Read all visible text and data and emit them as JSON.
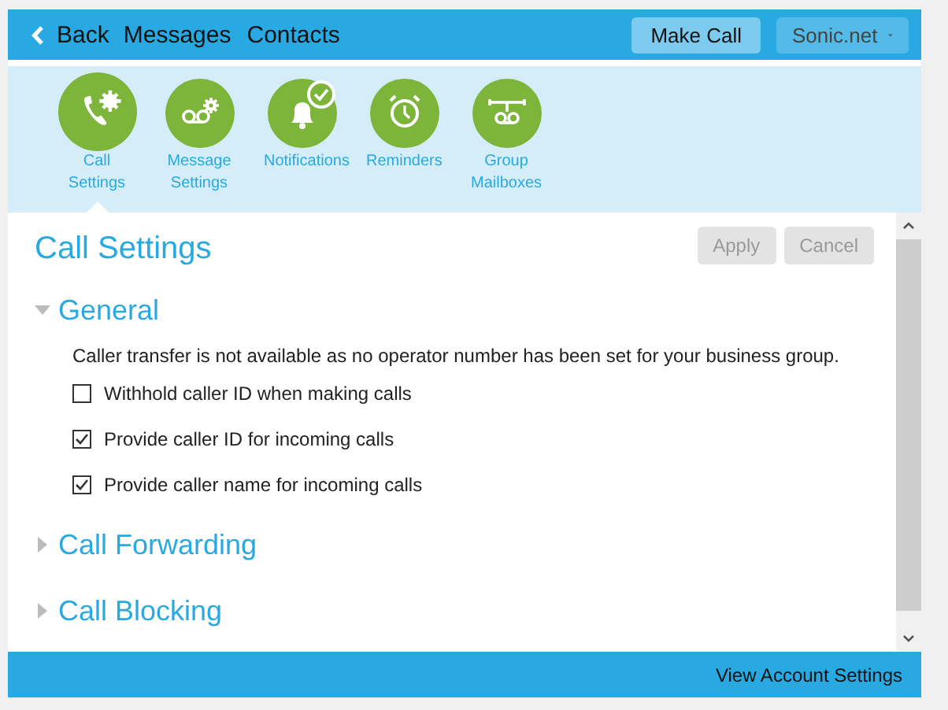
{
  "nav": {
    "back": "Back",
    "links": [
      "Messages",
      "Contacts"
    ],
    "make_call": "Make Call",
    "account": "Sonic.net"
  },
  "settings_tabs": [
    {
      "label": "Call Settings",
      "selected": true
    },
    {
      "label": "Message Settings",
      "selected": false
    },
    {
      "label": "Notifications",
      "selected": false
    },
    {
      "label": "Reminders",
      "selected": false
    },
    {
      "label": "Group Mailboxes",
      "selected": false
    }
  ],
  "panel": {
    "title": "Call Settings",
    "buttons": [
      {
        "label": "Apply",
        "disabled": true
      },
      {
        "label": "Cancel",
        "disabled": true
      }
    ],
    "sections": [
      {
        "title": "General",
        "expanded": true,
        "note": "Caller transfer is not available as no operator number has been set for your business group.",
        "options": [
          {
            "label": "Withhold caller ID when making calls",
            "checked": false
          },
          {
            "label": "Provide caller ID for incoming calls",
            "checked": true
          },
          {
            "label": "Provide caller name for incoming calls",
            "checked": true
          }
        ]
      },
      {
        "title": "Call Forwarding",
        "expanded": false
      },
      {
        "title": "Call Blocking",
        "expanded": false
      }
    ]
  },
  "footer": {
    "link": "View Account Settings"
  }
}
